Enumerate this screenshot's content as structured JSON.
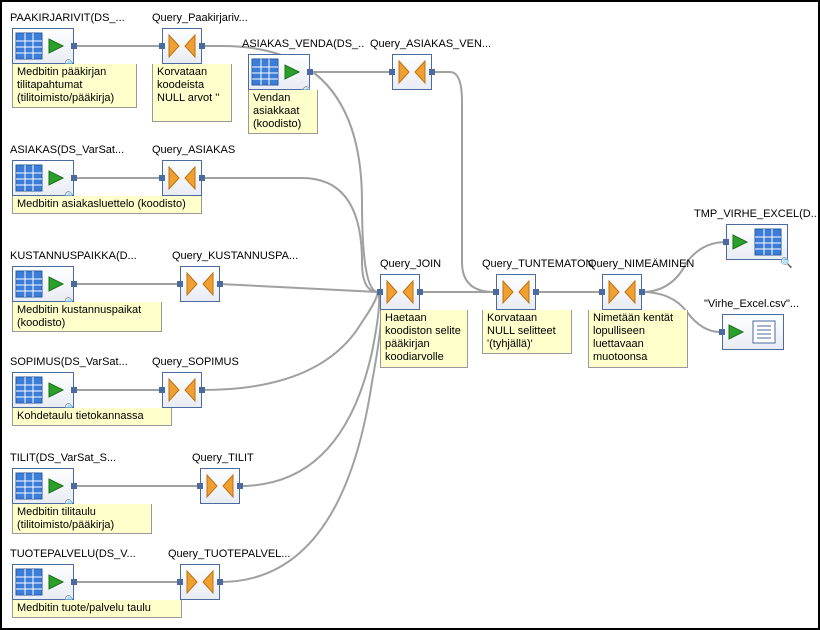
{
  "nodes": {
    "paakirjarivit": {
      "label": "PAAKIRJARIVIT(DS_...",
      "note": "Medbitin pääkirjan tilitapahtumat (tilitoimisto/pääkirja)"
    },
    "q_paakirjariv": {
      "label": "Query_Paakirjariv...",
      "note": "Korvataan koodeista NULL arvot ''"
    },
    "asiakas_venda": {
      "label": "ASIAKAS_VENDA(DS_..",
      "note": "Vendan asiakkaat (koodisto)"
    },
    "q_asiakas_ven": {
      "label": "Query_ASIAKAS_VEN..."
    },
    "asiakas": {
      "label": "ASIAKAS(DS_VarSat...",
      "note": "Medbitin asiakasluettelo (koodisto)"
    },
    "q_asiakas": {
      "label": "Query_ASIAKAS"
    },
    "kustannuspaikka": {
      "label": "KUSTANNUSPAIKKA(D...",
      "note": "Medbitin kustannuspaikat (koodisto)"
    },
    "q_kustannuspa": {
      "label": "Query_KUSTANNUSPA..."
    },
    "sopimus": {
      "label": "SOPIMUS(DS_VarSat...",
      "note": "Kohdetaulu tietokannassa"
    },
    "q_sopimus": {
      "label": "Query_SOPIMUS"
    },
    "tilit": {
      "label": "TILIT(DS_VarSat_S...",
      "note": "Medbitin tilitaulu (tilitoimisto/pääkirja)"
    },
    "q_tilit": {
      "label": "Query_TILIT"
    },
    "tuotepalvelu": {
      "label": "TUOTEPALVELU(DS_V...",
      "note": "Medbitin tuote/palvelu taulu"
    },
    "q_tuotepalvel": {
      "label": "Query_TUOTEPALVEL..."
    },
    "q_join": {
      "label": "Query_JOIN",
      "note": "Haetaan koodiston selite pääkirjan koodiarvolle"
    },
    "q_tuntematon": {
      "label": "Query_TUNTEMATON",
      "note": "Korvataan NULL selitteet '(tyhjällä)'"
    },
    "q_nimeaminen": {
      "label": "Query_NIMEÄMINEN",
      "note": "Nimetään kentät lopulliseen luettavaan muotoonsa"
    },
    "tmp_virhe": {
      "label": "TMP_VIRHE_EXCEL(D..."
    },
    "virhe_csv": {
      "label": "\"Virhe_Excel.csv\"..."
    }
  }
}
